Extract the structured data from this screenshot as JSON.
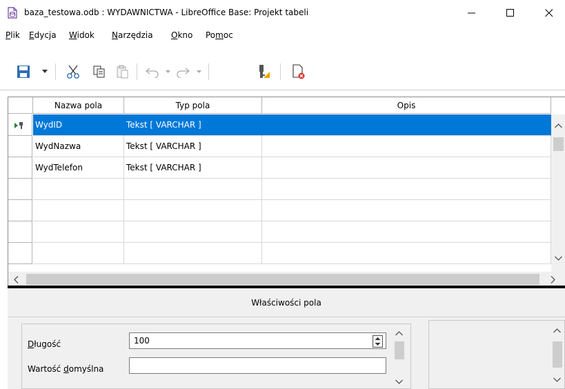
{
  "window": {
    "title": "baza_testowa.odb : WYDAWNICTWA - LibreOffice Base: Projekt tabeli",
    "min_glyph": "—",
    "max_glyph": "☐",
    "close_glyph": "✕"
  },
  "menu": [
    {
      "pre": "",
      "u": "P",
      "post": "lik"
    },
    {
      "pre": "",
      "u": "E",
      "post": "dycja"
    },
    {
      "pre": "",
      "u": "W",
      "post": "idok"
    },
    {
      "pre": "",
      "u": "N",
      "post": "arzędzia"
    },
    {
      "pre": "",
      "u": "O",
      "post": "kno"
    },
    {
      "pre": "Po",
      "u": "m",
      "post": "oc"
    }
  ],
  "toolbar": {
    "icons": [
      "save-icon",
      "dropdown-arrow-icon",
      "cut-icon",
      "copy-icon",
      "paste-icon",
      "undo-icon",
      "redo-icon",
      "primary-key-icon",
      "index-design-icon"
    ]
  },
  "table": {
    "columns": [
      "Nazwa pola",
      "Typ pola",
      "Opis"
    ],
    "rows": [
      {
        "name": "WydID",
        "type": "Tekst [ VARCHAR ]",
        "desc": "",
        "selected": true,
        "primary_key": true
      },
      {
        "name": "WydNazwa",
        "type": "Tekst [ VARCHAR ]",
        "desc": "",
        "selected": false,
        "primary_key": false
      },
      {
        "name": "WydTelefon",
        "type": "Tekst [ VARCHAR ]",
        "desc": "",
        "selected": false,
        "primary_key": false
      },
      {
        "name": "",
        "type": "",
        "desc": ""
      },
      {
        "name": "",
        "type": "",
        "desc": ""
      },
      {
        "name": "",
        "type": "",
        "desc": ""
      },
      {
        "name": "",
        "type": "",
        "desc": ""
      }
    ]
  },
  "properties": {
    "title": "Właściwości pola",
    "length_label_u": "D",
    "length_label_rest": "ługość",
    "length_value": "100",
    "default_label_pre": "Wartość ",
    "default_label_u": "d",
    "default_label_post": "omyślna",
    "default_value": ""
  },
  "colors": {
    "selection": "#0078d7",
    "save_icon": "#2f6fb5",
    "close_badge": "#e0312b"
  }
}
